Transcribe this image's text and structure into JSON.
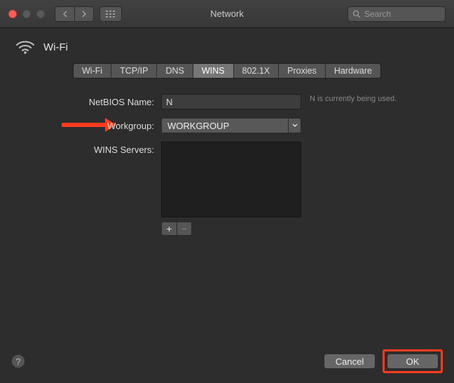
{
  "window": {
    "title": "Network"
  },
  "search": {
    "placeholder": "Search"
  },
  "header": {
    "service_name": "Wi-Fi"
  },
  "tabs": [
    "Wi-Fi",
    "TCP/IP",
    "DNS",
    "WINS",
    "802.1X",
    "Proxies",
    "Hardware"
  ],
  "active_tab": "WINS",
  "form": {
    "netbios": {
      "label": "NetBIOS Name:",
      "value": "N",
      "hint": "N          is currently being used."
    },
    "workgroup": {
      "label": "Workgroup:",
      "value": "WORKGROUP"
    },
    "wins_servers": {
      "label": "WINS Servers:"
    }
  },
  "buttons": {
    "add": "+",
    "remove": "−",
    "help": "?",
    "cancel": "Cancel",
    "ok": "OK"
  }
}
